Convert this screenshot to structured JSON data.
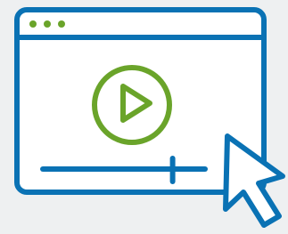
{
  "illustration": {
    "icon": "video-player-icon",
    "description_icons": [
      "browser-window-icon",
      "play-icon",
      "cursor-arrow-icon"
    ],
    "colors": {
      "background": "#eef0f1",
      "outline": "#0a72b4",
      "accent": "#6aa42a",
      "fill": "#ffffff"
    },
    "window_dots": 3,
    "playback_progress": 0.8
  }
}
